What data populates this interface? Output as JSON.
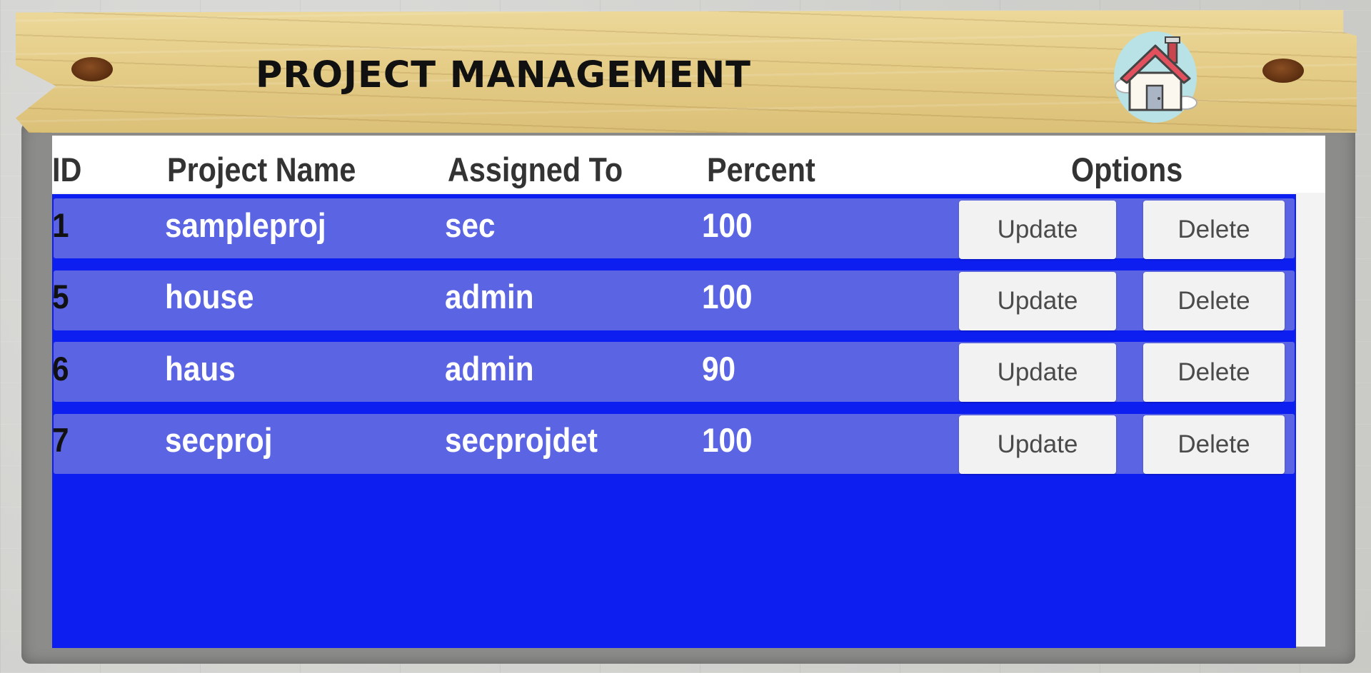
{
  "header": {
    "title": "PROJECT MANAGEMENT",
    "home_icon": "house-icon"
  },
  "table": {
    "columns": [
      "ID",
      "Project Name",
      "Assigned To",
      "Percent",
      "Options"
    ],
    "rows": [
      {
        "id": "1",
        "name": "sampleproj",
        "assigned": "sec",
        "percent": "100",
        "update_label": "Update",
        "delete_label": "Delete"
      },
      {
        "id": "5",
        "name": "house",
        "assigned": "admin",
        "percent": "100",
        "update_label": "Update",
        "delete_label": "Delete"
      },
      {
        "id": "6",
        "name": "haus",
        "assigned": "admin",
        "percent": "90",
        "update_label": "Update",
        "delete_label": "Delete"
      },
      {
        "id": "7",
        "name": "secproj",
        "assigned": "secprojdet",
        "percent": "100",
        "update_label": "Update",
        "delete_label": "Delete"
      }
    ]
  },
  "colors": {
    "table_background": "#0d1ef0",
    "row_background": "#5b65e3",
    "plank": "#e5cd88"
  }
}
